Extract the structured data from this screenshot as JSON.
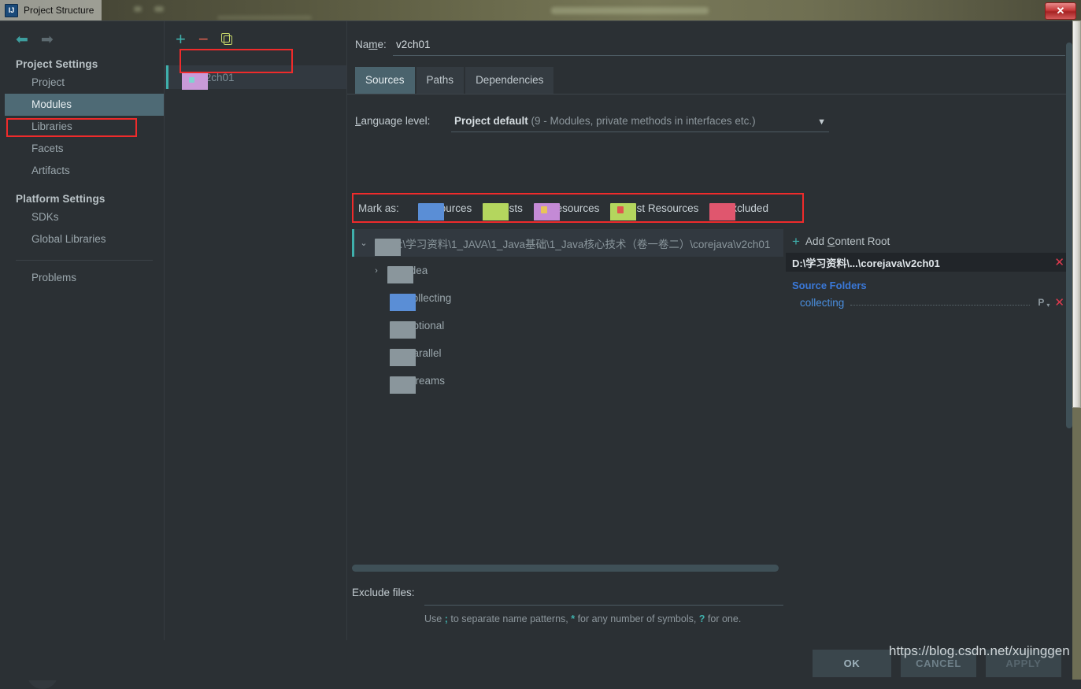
{
  "window": {
    "title": "Project Structure",
    "app_icon": "intellij-idea-icon",
    "close_label": "✕"
  },
  "sidebar": {
    "nav": {
      "back_icon": "arrow-left-icon",
      "forward_icon": "arrow-right-icon"
    },
    "groups": [
      {
        "title": "Project Settings",
        "items": [
          {
            "label": "Project",
            "selected": false
          },
          {
            "label": "Modules",
            "selected": true
          },
          {
            "label": "Libraries",
            "selected": false
          },
          {
            "label": "Facets",
            "selected": false
          },
          {
            "label": "Artifacts",
            "selected": false
          }
        ]
      },
      {
        "title": "Platform Settings",
        "items": [
          {
            "label": "SDKs",
            "selected": false
          },
          {
            "label": "Global Libraries",
            "selected": false
          }
        ]
      }
    ],
    "problems_label": "Problems",
    "help_icon": "help-question-icon"
  },
  "modules_panel": {
    "toolbar": {
      "add_label": "+",
      "remove_label": "−",
      "copy_icon": "copy-icon"
    },
    "items": [
      {
        "label": "v2ch01",
        "icon": "module-folder-icon",
        "selected": true
      }
    ]
  },
  "main": {
    "name_label_pre": "Na",
    "name_label_mnemonic": "m",
    "name_label_post": "e:",
    "name_value": "v2ch01",
    "tabs": [
      {
        "label": "Sources",
        "active": true
      },
      {
        "label": "Paths",
        "active": false
      },
      {
        "label": "Dependencies",
        "active": false
      }
    ],
    "language_level": {
      "label_mnemonic": "L",
      "label_rest": "anguage level:",
      "value_bold": "Project default",
      "value_dim": "(9 - Modules, private methods in interfaces etc.)",
      "arrow": "▼"
    },
    "mark_as": {
      "label": "Mark as:",
      "options": [
        {
          "mnemonic": "S",
          "rest": "ources",
          "color": "#5a8ed6",
          "overlay": ""
        },
        {
          "mnemonic": "T",
          "rest": "ests",
          "color": "#b4d65e",
          "overlay": ""
        },
        {
          "mnemonic": "R",
          "rest": "esources",
          "color": "#c48ad6",
          "overlay": "#e8c45a"
        },
        {
          "mnemonic": "T",
          "rest": "est Resources",
          "color": "#b4d65e",
          "overlay": "#e0564e"
        },
        {
          "mnemonic": "E",
          "rest": "xcluded",
          "color": "#e0566e",
          "overlay": ""
        }
      ]
    },
    "tree": {
      "root": {
        "label": "D:\\学习资料\\1_JAVA\\1_Java基础\\1_Java核心技术（卷一卷二）\\corejava\\v2ch01",
        "expander": "⌄",
        "icon": "folder-icon",
        "color": "#8a969c"
      },
      "children": [
        {
          "label": ".idea",
          "expander": "›",
          "icon": "folder-icon",
          "color": "#8a969c",
          "marked": false
        },
        {
          "label": "collecting",
          "expander": "",
          "icon": "folder-source-icon",
          "color": "#5a8ed6",
          "marked": true
        },
        {
          "label": "optional",
          "expander": "",
          "icon": "folder-icon",
          "color": "#8a969c",
          "marked": false
        },
        {
          "label": "parallel",
          "expander": "",
          "icon": "folder-icon",
          "color": "#8a969c",
          "marked": false
        },
        {
          "label": "streams",
          "expander": "",
          "icon": "folder-icon",
          "color": "#8a969c",
          "marked": false
        }
      ]
    },
    "exclude": {
      "label": "Exclude files:",
      "value": "",
      "hint_1": "Use ",
      "hint_semicolon": ";",
      "hint_2": " to separate name patterns, ",
      "hint_star": "*",
      "hint_3": " for any number of symbols, ",
      "hint_q": "?",
      "hint_4": " for one."
    }
  },
  "content_root_panel": {
    "add_content_root": {
      "plus": "+",
      "pre": "Add ",
      "mnemonic": "C",
      "post": "ontent Root"
    },
    "root_path": "D:\\学习资料\\...\\corejava\\v2ch01",
    "root_remove_icon": "close-x-icon",
    "source_folders_title": "Source Folders",
    "source_folders": [
      {
        "name": "collecting",
        "package_prefix_icon": "package-prefix-icon",
        "remove_icon": "close-x-icon"
      }
    ]
  },
  "buttons": {
    "ok": "OK",
    "cancel": "CANCEL",
    "apply": "APPLY"
  },
  "watermark": "https://blog.csdn.net/xujinggen",
  "colors": {
    "accent_teal": "#3fb0ac",
    "annotation_red": "#ef2b2b",
    "selection_blue": "#4e6a75",
    "link_blue": "#4a8fe0",
    "danger_red": "#e03a4e"
  }
}
